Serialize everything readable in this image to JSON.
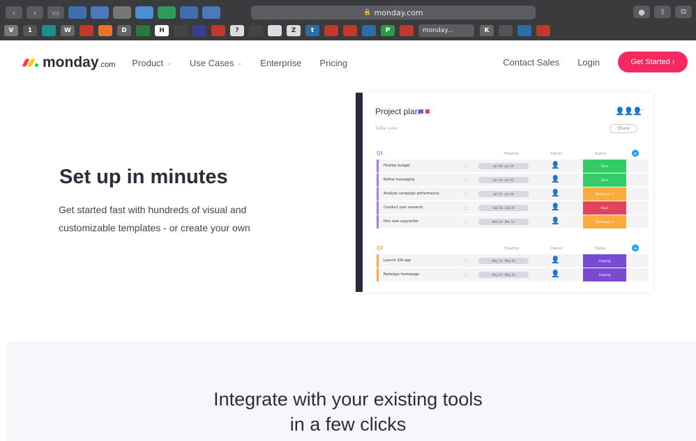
{
  "browser": {
    "url": "monday.com",
    "active_tab_label": "monday...",
    "bookmark_letters": [
      "V",
      "1",
      "",
      "W",
      "",
      "",
      "D",
      "",
      "H",
      "",
      "",
      "",
      "?",
      "",
      "",
      "Z",
      "t",
      "",
      "",
      "",
      "P",
      "",
      "K",
      "",
      "",
      ""
    ]
  },
  "nav": {
    "logo_text": "monday",
    "logo_suffix": ".com",
    "links": [
      {
        "label": "Product",
        "dropdown": true
      },
      {
        "label": "Use Cases",
        "dropdown": true
      },
      {
        "label": "Enterprise",
        "dropdown": false
      },
      {
        "label": "Pricing",
        "dropdown": false
      }
    ],
    "contact_sales": "Contact Sales",
    "login": "Login",
    "get_started": "Get Started  ›"
  },
  "hero": {
    "title": "Set up in minutes",
    "subtitle_line1": "Get started fast with hundreds of visual and",
    "subtitle_line2": "customizable templates - or create your own"
  },
  "board": {
    "title": "Project plan",
    "view_label": "Table view",
    "share_label": "Share",
    "menu": "···",
    "columns": {
      "timeline": "Timeline",
      "owner": "Owner",
      "status": "Status"
    },
    "groups": [
      {
        "label": "Q1",
        "color": "#a77bf0",
        "rows": [
          {
            "name": "Finalize budget",
            "timeline": "Jan 08 - Jan 14",
            "status": "Done",
            "status_color": "#33cc66"
          },
          {
            "name": "Refine messaging",
            "timeline": "Jan 20 - Jan 23",
            "status": "Done",
            "status_color": "#33cc66"
          },
          {
            "name": "Analyze campaign performance",
            "timeline": "Jan 22 - Jan 24",
            "status": "Working on it",
            "status_color": "#fcab3c"
          },
          {
            "name": "Conduct user research",
            "timeline": "Feb 16 - Feb 20",
            "status": "Stuck",
            "status_color": "#e2445c"
          },
          {
            "name": "Hire new copywriter",
            "timeline": "Mar 10 - Mar 13",
            "status": "Working on it",
            "status_color": "#fcab3c"
          }
        ]
      },
      {
        "label": "Q2",
        "color": "#fcab3c",
        "rows": [
          {
            "name": "Launch iOS app",
            "timeline": "May 14 - May 18",
            "status": "Ongoing",
            "status_color": "#784bd1"
          },
          {
            "name": "Redesign homepage",
            "timeline": "May 07 - May 24",
            "status": "Ongoing",
            "status_color": "#784bd1"
          }
        ]
      }
    ]
  },
  "section2": {
    "title_line1": "Integrate with your existing tools",
    "title_line2": "in a few clicks"
  },
  "colors": {
    "brand_pink": "#f5285f",
    "logo_red": "#ff3d57",
    "logo_yellow": "#ffcb00",
    "logo_green": "#00d647",
    "board_bar": "#2a2a3e"
  }
}
